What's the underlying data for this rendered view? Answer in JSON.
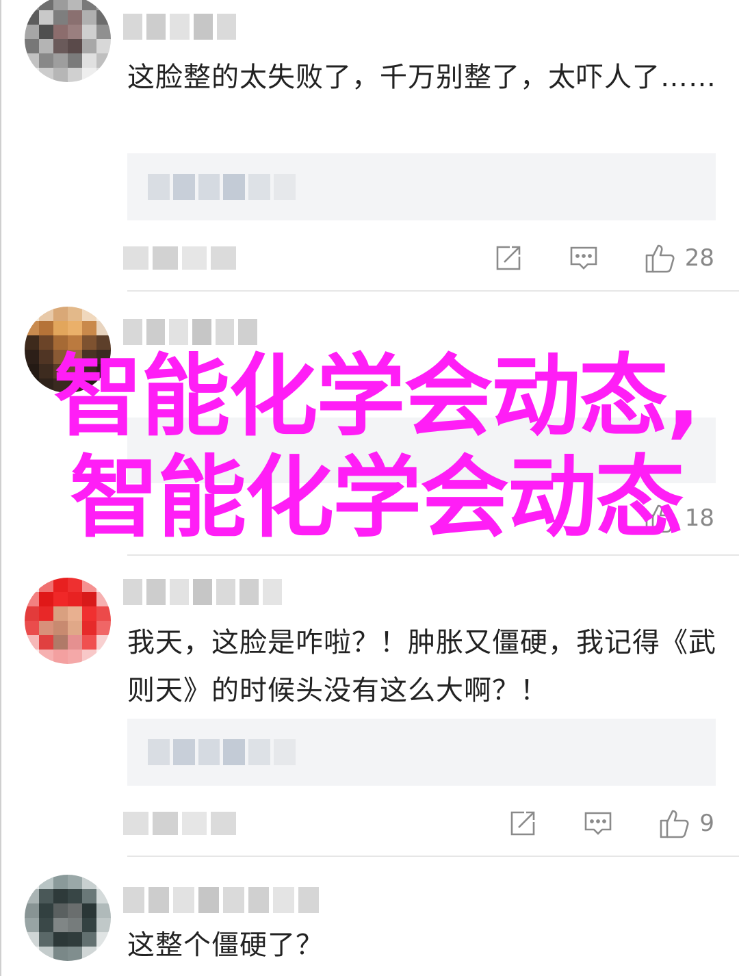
{
  "comments": [
    {
      "text": "这脸整的太失败了，千万别整了，太吓人了……",
      "likes": "28"
    },
    {
      "text": "",
      "likes": "18"
    },
    {
      "text": "我天，这脸是咋啦？！肿胀又僵硬，我记得《武则天》的时候头没有这么大啊？！",
      "likes": "9"
    },
    {
      "text": "这整个僵硬了？",
      "likes": ""
    }
  ],
  "overlay": {
    "title": "智能化学会动态,智能化学会动态"
  },
  "icons": {
    "share": "share-icon",
    "reply": "reply-icon",
    "like": "thumbs-up-icon"
  },
  "colors": {
    "overlay_text": "#ff1ef6",
    "count_text": "#888888",
    "quote_bg": "#f3f4f6"
  }
}
